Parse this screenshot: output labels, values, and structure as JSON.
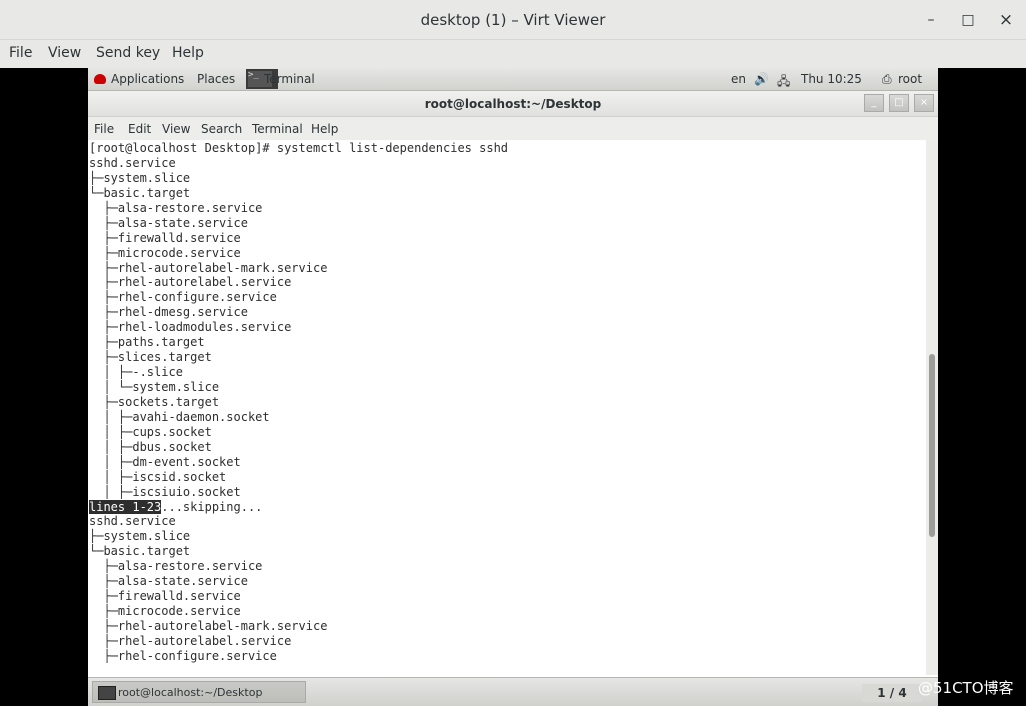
{
  "window": {
    "title": "desktop (1) – Virt Viewer",
    "minimize": "–",
    "maximize": "□",
    "close": "×"
  },
  "viewer_menu": [
    "File",
    "View",
    "Send key",
    "Help"
  ],
  "gnome_panel": {
    "applications": "Applications",
    "places": "Places",
    "terminal_task": "Terminal",
    "lang": "en",
    "clock": "Thu 10:25",
    "user": "root"
  },
  "terminal": {
    "title": "root@localhost:~/Desktop",
    "menu": [
      "File",
      "Edit",
      "View",
      "Search",
      "Terminal",
      "Help"
    ],
    "lines": [
      "[root@localhost Desktop]# systemctl list-dependencies sshd",
      "sshd.service",
      "├─system.slice",
      "└─basic.target",
      "  ├─alsa-restore.service",
      "  ├─alsa-state.service",
      "  ├─firewalld.service",
      "  ├─microcode.service",
      "  ├─rhel-autorelabel-mark.service",
      "  ├─rhel-autorelabel.service",
      "  ├─rhel-configure.service",
      "  ├─rhel-dmesg.service",
      "  ├─rhel-loadmodules.service",
      "  ├─paths.target",
      "  ├─slices.target",
      "  │ ├─-.slice",
      "  │ └─system.slice",
      "  ├─sockets.target",
      "  │ ├─avahi-daemon.socket",
      "  │ ├─cups.socket",
      "  │ ├─dbus.socket",
      "  │ ├─dm-event.socket",
      "  │ ├─iscsid.socket",
      "  │ ├─iscsiuio.socket",
      "",
      "sshd.service",
      "├─system.slice",
      "└─basic.target",
      "  ├─alsa-restore.service",
      "  ├─alsa-state.service",
      "  ├─firewalld.service",
      "  ├─microcode.service",
      "  ├─rhel-autorelabel-mark.service",
      "  ├─rhel-autorelabel.service",
      "  ├─rhel-configure.service"
    ],
    "pager_highlight": "lines 1-23",
    "pager_rest": "...skipping..."
  },
  "taskbar": {
    "task_label": "root@localhost:~/Desktop",
    "workspace": "1 / 4"
  },
  "watermark": "@51CTO博客"
}
